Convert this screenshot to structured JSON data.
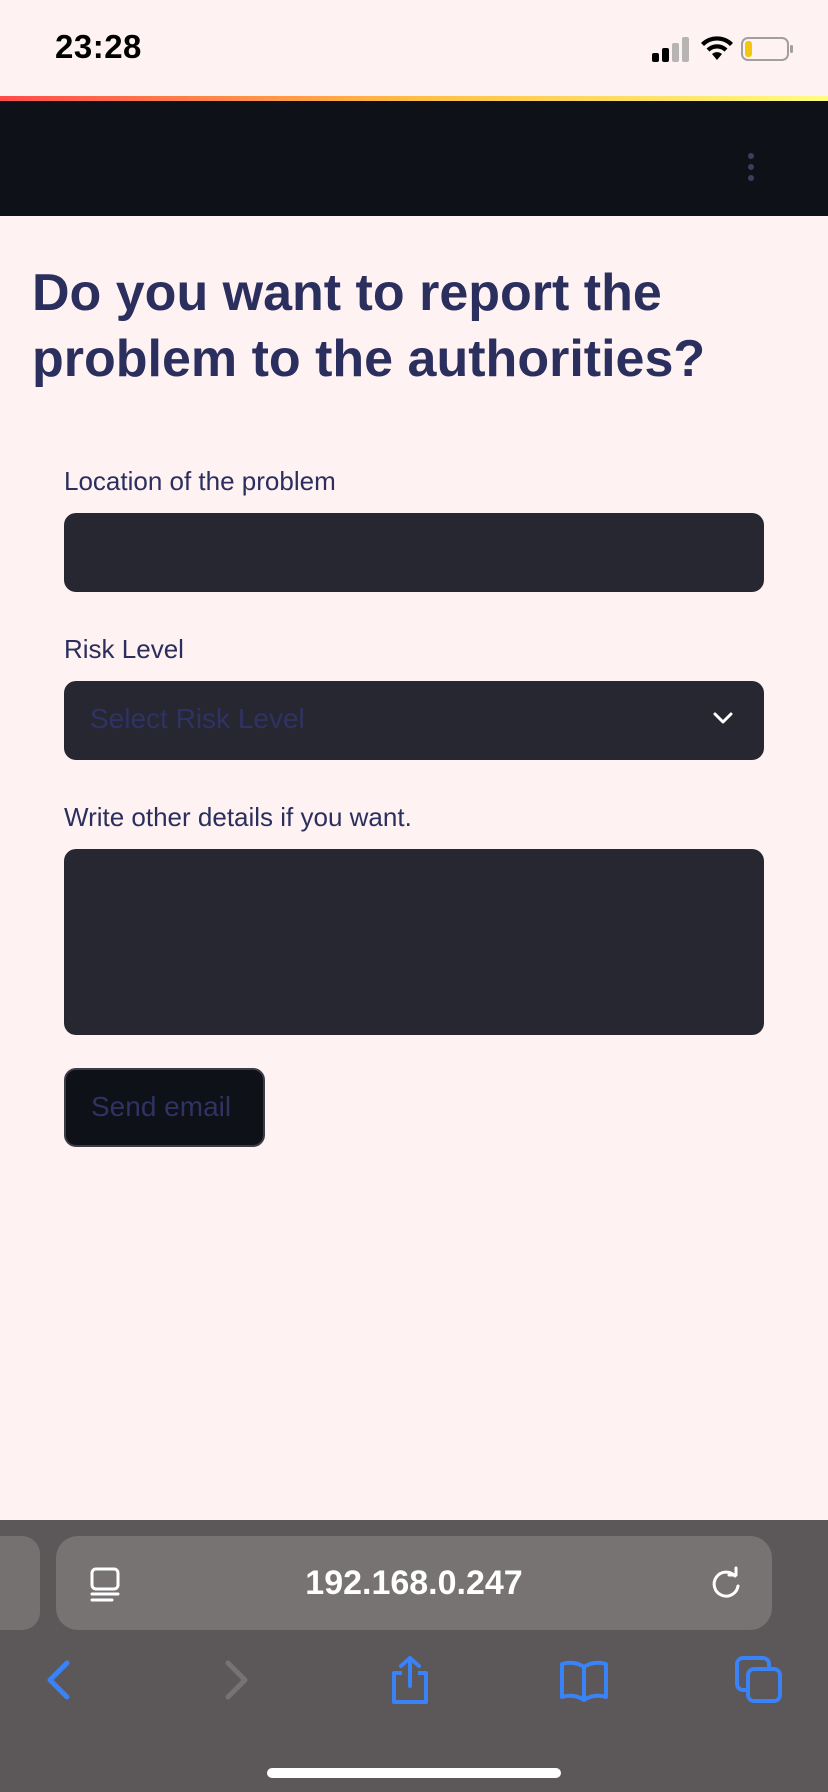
{
  "status_bar": {
    "time": "23:28"
  },
  "main": {
    "title": "Do you want to report the problem to the authorities?",
    "location_label": "Location of the problem",
    "location_value": "",
    "risk_label": "Risk Level",
    "risk_placeholder": "Select Risk Level",
    "details_label": "Write other details if you want.",
    "details_value": "",
    "send_button": "Send email"
  },
  "browser": {
    "address": "192.168.0.247"
  },
  "colors": {
    "page_background": "#fff2f2",
    "header_background": "#0e1117",
    "input_background": "#262730",
    "text": "#2b2f5e",
    "safari_blue": "#3a82f7"
  },
  "icons": {
    "menu": "vertical-dots-icon",
    "select_chevron": "chevron-down-icon",
    "address_left": "page-menu-icon",
    "address_right": "reload-icon",
    "toolbar": [
      "back-icon",
      "forward-icon",
      "share-icon",
      "bookmarks-icon",
      "tabs-icon"
    ]
  }
}
